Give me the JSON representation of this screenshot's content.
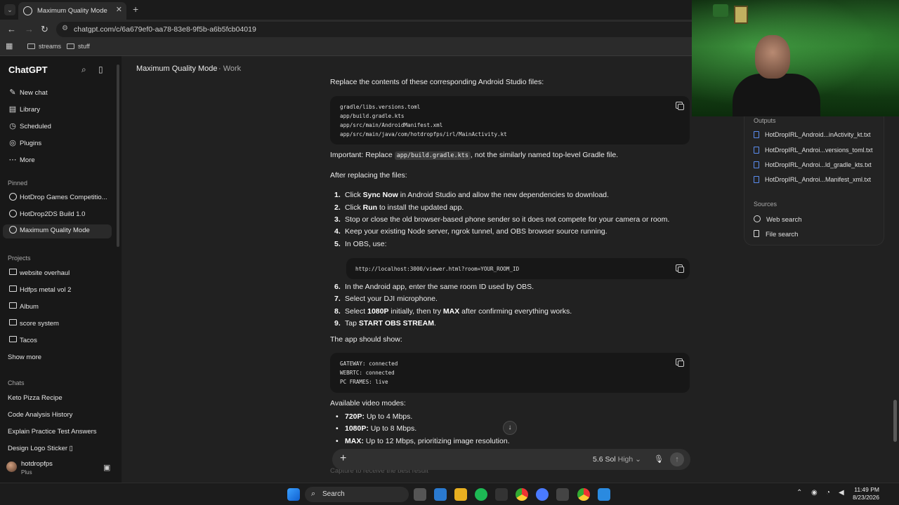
{
  "browser": {
    "tab_title": "Maximum Quality Mode",
    "url": "chatgpt.com/c/6a679ef0-aa78-83e8-9f5b-a6b5fcb04019",
    "bookmarks": [
      "streams",
      "stuff"
    ]
  },
  "sidebar": {
    "brand": "ChatGPT",
    "nav": [
      {
        "label": "New chat",
        "icon": "new-chat-icon"
      },
      {
        "label": "Library",
        "icon": "library-icon"
      },
      {
        "label": "Scheduled",
        "icon": "scheduled-icon"
      },
      {
        "label": "Plugins",
        "icon": "plugins-icon"
      },
      {
        "label": "More",
        "icon": "more-icon"
      }
    ],
    "pinned_header": "Pinned",
    "pinned": [
      "HotDrop Games Competitio...",
      "HotDrop2DS Build 1.0",
      "Maximum Quality Mode"
    ],
    "projects_header": "Projects",
    "projects": [
      "website overhaul",
      "Hdfps metal vol 2",
      "Album",
      "score system",
      "Tacos"
    ],
    "show_more": "Show more",
    "chats_header": "Chats",
    "chats": [
      "Keto Pizza Recipe",
      "Code Analysis History",
      "Explain Practice Test Answers",
      "Design Logo Sticker ▯"
    ],
    "user": {
      "name": "hotdropfps",
      "plan": "Plus"
    }
  },
  "main": {
    "title": "Maximum Quality Mode",
    "tag": "· Work",
    "intro": "Replace the contents of these corresponding Android Studio files:",
    "files_code": "gradle/libs.versions.toml\napp/build.gradle.kts\napp/src/main/AndroidManifest.xml\napp/src/main/java/com/hotdropfps/irl/MainActivity.kt",
    "important_prefix": "Important: Replace ",
    "important_code": "app/build.gradle.kts",
    "important_suffix": ", not the similarly named top-level Gradle file.",
    "after": "After replacing the files:",
    "steps_a": [
      {
        "n": "1.",
        "pre": "Click ",
        "b": "Sync Now",
        "post": " in Android Studio and allow the new dependencies to download."
      },
      {
        "n": "2.",
        "pre": "Click ",
        "b": "Run",
        "post": " to install the updated app."
      },
      {
        "n": "3.",
        "pre": "Stop or close the old browser-based phone sender so it does not compete for your camera or room.",
        "b": "",
        "post": ""
      },
      {
        "n": "4.",
        "pre": "Keep your existing Node server, ngrok tunnel, and OBS browser source running.",
        "b": "",
        "post": ""
      },
      {
        "n": "5.",
        "pre": "In OBS, use:",
        "b": "",
        "post": ""
      }
    ],
    "obs_code": "http://localhost:3000/viewer.html?room=YOUR_ROOM_ID",
    "steps_b": [
      {
        "n": "6.",
        "pre": "In the Android app, enter the same room ID used by OBS.",
        "b": "",
        "post": ""
      },
      {
        "n": "7.",
        "pre": "Select your DJI microphone.",
        "b": "",
        "post": ""
      },
      {
        "n": "8.",
        "pre": "Select ",
        "b": "1080P",
        "post": " initially, then try ",
        "b2": "MAX",
        "post2": " after confirming everything works."
      },
      {
        "n": "9.",
        "pre": "Tap ",
        "b": "START OBS STREAM",
        "post": "."
      }
    ],
    "should_show": "The app should show:",
    "status_code": "GATEWAY: connected\nWEBRTC: connected\nPC FRAMES: live",
    "modes_header": "Available video modes:",
    "modes": [
      {
        "b": "720P:",
        "t": " Up to 4 Mbps."
      },
      {
        "b": "1080P:",
        "t": " Up to 8 Mbps."
      },
      {
        "b": "MAX:",
        "t": " Up to 12 Mbps, prioritizing image resolution."
      }
    ],
    "faded_text": "Capture to receive the best result"
  },
  "composer": {
    "model": "5.6 Sol",
    "effort": "High"
  },
  "panel": {
    "outputs_header": "Outputs",
    "outputs": [
      "HotDropIRL_Android...inActivity_kt.txt",
      "HotDropIRL_Androi...versions_toml.txt",
      "HotDropIRL_Androi...ld_gradle_kts.txt",
      "HotDropIRL_Androi...Manifest_xml.txt"
    ],
    "sources_header": "Sources",
    "sources": [
      "Web search",
      "File search"
    ]
  },
  "taskbar": {
    "search": "Search",
    "time": "11:49 PM",
    "date": "8/23/2026"
  },
  "colors": {
    "accent": "#5b8df0",
    "bg": "#212121",
    "sidebar": "#181818"
  }
}
